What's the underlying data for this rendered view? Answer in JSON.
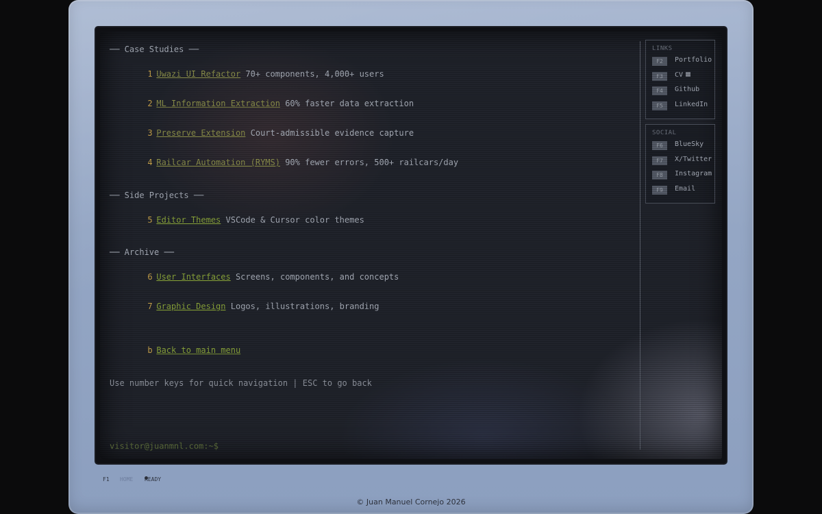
{
  "sections": {
    "case_studies": "── Case Studies ──",
    "side_projects": "── Side Projects ──",
    "archive": "── Archive ──"
  },
  "menu": [
    {
      "num": "1",
      "link": "Uwazi UI Refactor",
      "desc": " 70+ components, 4,000+ users"
    },
    {
      "num": "2",
      "link": "ML Information Extraction",
      "desc": " 60% faster data extraction"
    },
    {
      "num": "3",
      "link": "Preserve Extension",
      "desc": " Court-admissible evidence capture"
    },
    {
      "num": "4",
      "link": "Railcar Automation (RYMS)",
      "desc": " 90% fewer errors, 500+ railcars/day"
    },
    {
      "num": "5",
      "link": "Editor Themes",
      "desc": " VSCode & Cursor color themes"
    },
    {
      "num": "6",
      "link": "User Interfaces",
      "desc": " Screens, components, and concepts"
    },
    {
      "num": "7",
      "link": "Graphic Design",
      "desc": " Logos, illustrations, branding"
    }
  ],
  "back": {
    "key": "b",
    "label": "Back to main menu"
  },
  "hint": "Use number keys for quick navigation | ESC to go back",
  "prompt": "visitor@juanmnl.com:~$",
  "links_panel": {
    "title": "LINKS",
    "items": [
      {
        "key": "F2",
        "label": "Portfolio"
      },
      {
        "key": "F3",
        "label": "CV"
      },
      {
        "key": "F4",
        "label": "Github"
      },
      {
        "key": "F5",
        "label": "LinkedIn"
      }
    ]
  },
  "social_panel": {
    "title": "SOCIAL",
    "items": [
      {
        "key": "F6",
        "label": "BlueSky"
      },
      {
        "key": "F7",
        "label": "X/Twitter"
      },
      {
        "key": "F8",
        "label": "Instagram"
      },
      {
        "key": "F9",
        "label": "Email"
      }
    ]
  },
  "status": {
    "f1": "F1",
    "mode": "HOME",
    "state": "READY"
  },
  "footer": "© Juan Manuel Cornejo 2026"
}
